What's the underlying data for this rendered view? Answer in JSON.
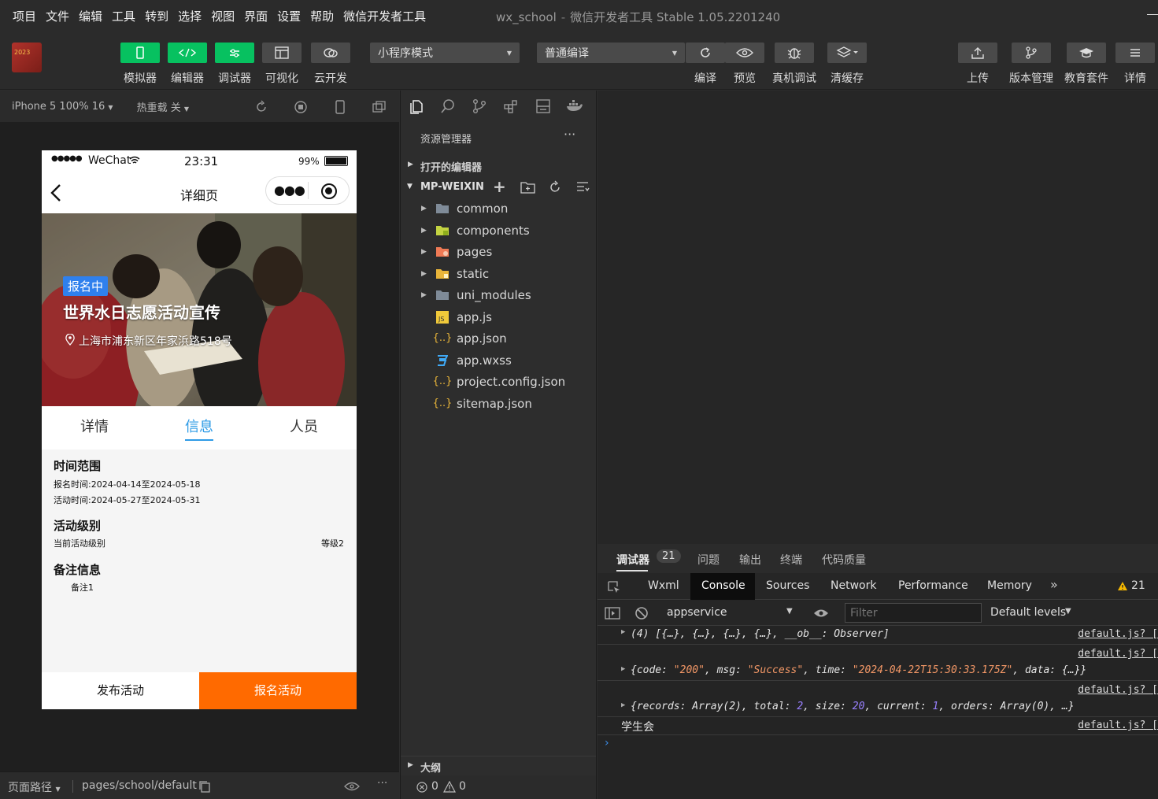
{
  "menu": [
    "项目",
    "文件",
    "编辑",
    "工具",
    "转到",
    "选择",
    "视图",
    "界面",
    "设置",
    "帮助",
    "微信开发者工具"
  ],
  "window": {
    "project": "wx_school",
    "separator": "-",
    "app": "微信开发者工具 Stable 1.05.2201240"
  },
  "logo_text": "2023",
  "toolbar": {
    "simulator": "模拟器",
    "editor": "编辑器",
    "debugger": "调试器",
    "visual": "可视化",
    "cloud": "云开发",
    "mode_select": "小程序模式",
    "compile_select": "普通编译",
    "compile": "编译",
    "preview": "预览",
    "real_debug": "真机调试",
    "clear_cache": "清缓存",
    "upload": "上传",
    "version": "版本管理",
    "edu": "教育套件",
    "details": "详情"
  },
  "sim_header": {
    "device": "iPhone 5 100% 16",
    "hot_reload": "热重载 关"
  },
  "phone": {
    "carrier": "WeChat",
    "time": "23:31",
    "battery": "99%",
    "nav_title": "详细页",
    "badge": "报名中",
    "event_title": "世界水日志愿活动宣传",
    "address": "上海市浦东新区年家浜路518号",
    "tabs": [
      "详情",
      "信息",
      "人员"
    ],
    "sections": {
      "time_title": "时间范围",
      "signup_time": "报名时间:2024-04-14至2024-05-18",
      "activity_time": "活动时间:2024-05-27至2024-05-31",
      "level_title": "活动级别",
      "level_label": "当前活动级别",
      "level_value": "等级2",
      "note_title": "备注信息",
      "note_value": "备注1"
    },
    "publish_btn": "发布活动",
    "signup_btn": "报名活动"
  },
  "status_bar": {
    "page_path_label": "页面路径",
    "page_path": "pages/school/default"
  },
  "explorer": {
    "title": "资源管理器",
    "open_editors": "打开的编辑器",
    "project": "MP-WEIXIN",
    "items": [
      "common",
      "components",
      "pages",
      "static",
      "uni_modules",
      "app.js",
      "app.json",
      "app.wxss",
      "project.config.json",
      "sitemap.json"
    ],
    "outline": "大纲",
    "errors": "0",
    "warnings": "0"
  },
  "devtools": {
    "top_tabs": [
      "调试器",
      "问题",
      "输出",
      "终端",
      "代码质量"
    ],
    "badge": "21",
    "tabs": [
      "Wxml",
      "Console",
      "Sources",
      "Network",
      "Performance",
      "Memory"
    ],
    "warn_count": "21",
    "context": "appservice",
    "filter_placeholder": "Filter",
    "levels": "Default levels",
    "src": "default.js? [",
    "log4": "学生会"
  },
  "colors": {
    "green": "#07c160",
    "orange": "#ff6a00",
    "blue_tab": "#2e9be6",
    "badge_blue": "#2f80ed"
  }
}
